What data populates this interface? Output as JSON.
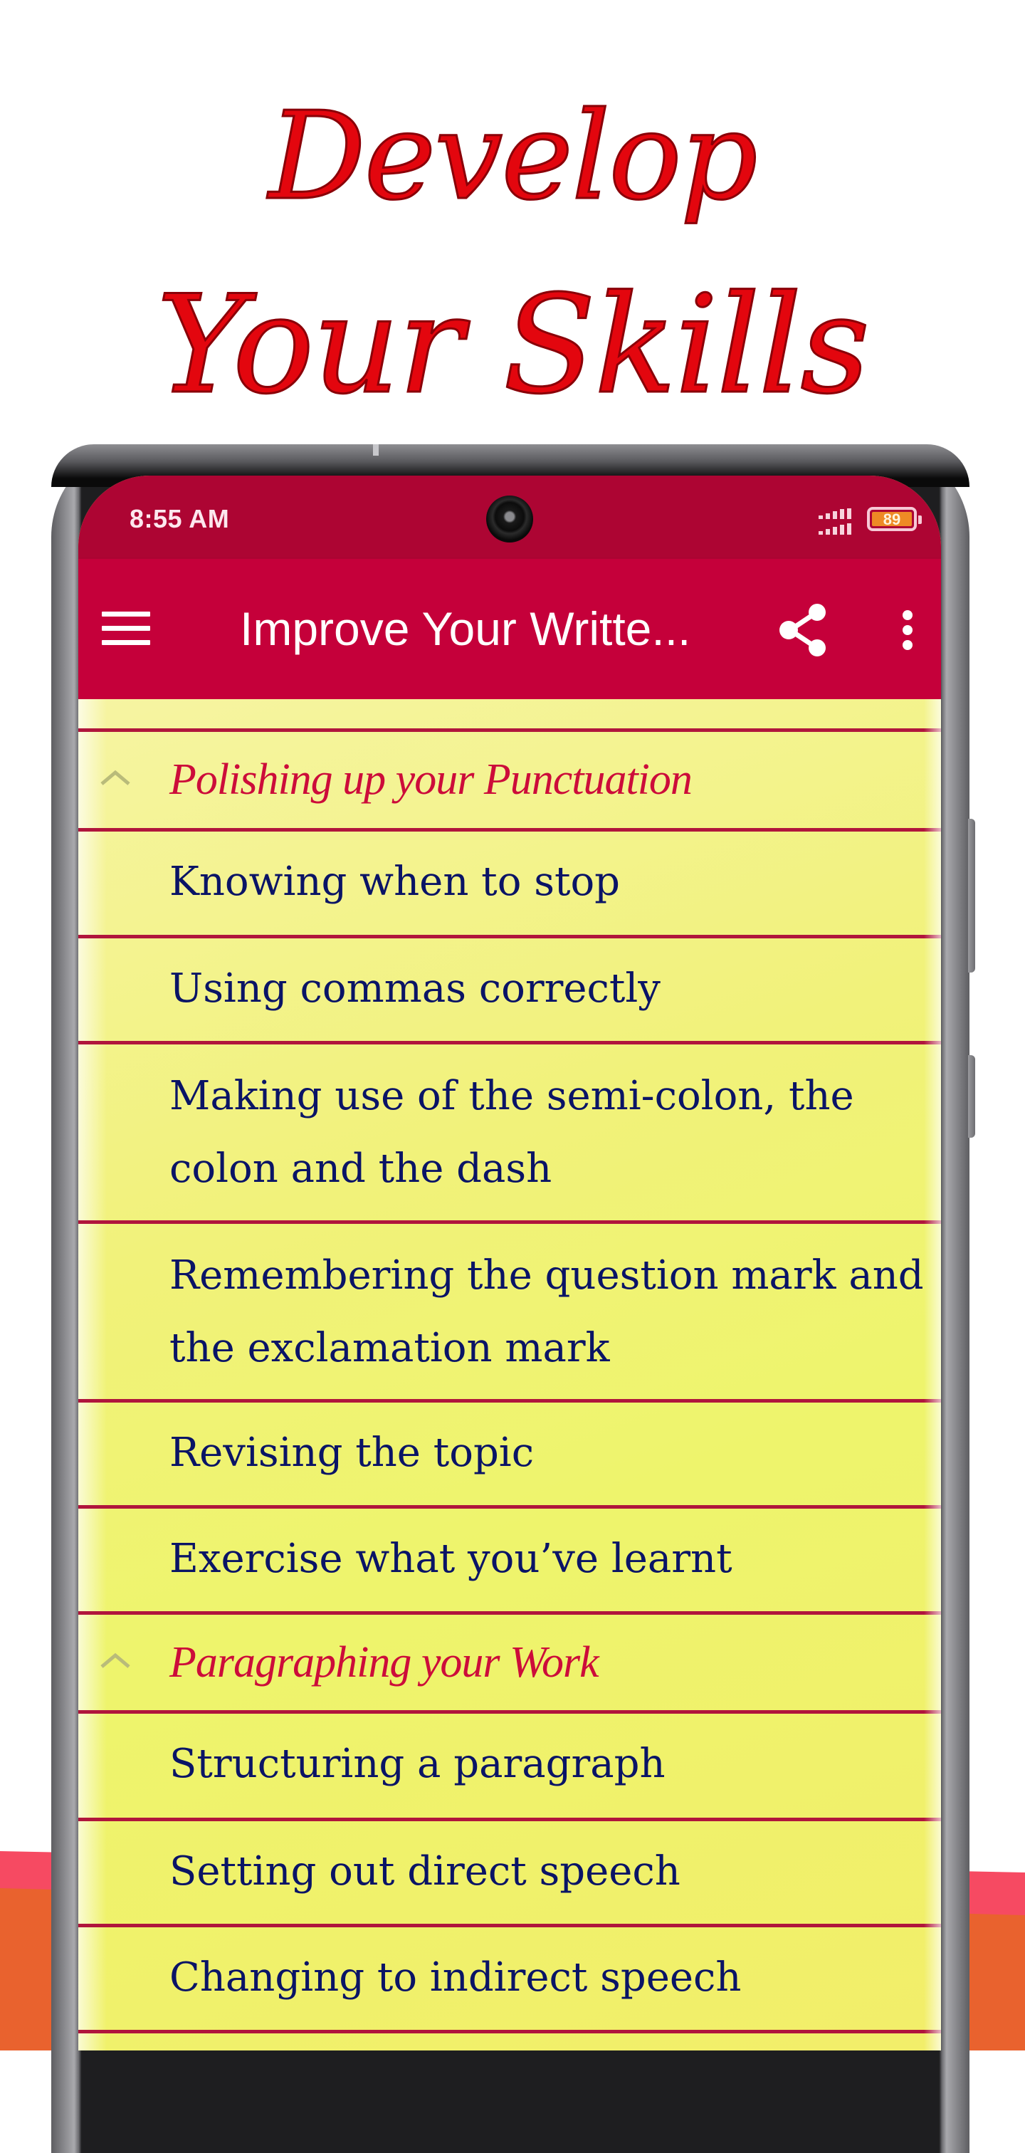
{
  "headline": {
    "line1": "Develop",
    "line2": "Your Skills"
  },
  "status_bar": {
    "time": "8:55 AM",
    "battery_level": "89",
    "icons": [
      "signal-icon",
      "battery-icon"
    ]
  },
  "app_bar": {
    "title": "Improve Your Writte...",
    "menu_icon": "hamburger-icon",
    "share_icon": "share-icon",
    "more_icon": "more-vertical-icon"
  },
  "colors": {
    "status_bar": "#ad0533",
    "app_bar": "#c5003a",
    "list_bg": "#f1f27a",
    "divider": "#b0153c",
    "header_text": "#cc0c3a",
    "item_text": "#0a1466",
    "headline": "#e3060e"
  },
  "list": {
    "sections": [
      {
        "title": "Polishing up your Punctuation",
        "expanded": true,
        "items": [
          "Knowing when to stop",
          "Using commas correctly",
          "Making use of the semi-colon, the colon and the dash",
          "Remembering the question mark and the exclamation mark",
          "Revising the topic",
          "Exercise what you’ve learnt"
        ]
      },
      {
        "title": "Paragraphing your Work",
        "expanded": true,
        "items": [
          "Structuring a paragraph",
          "Setting out direct speech",
          "Changing to indirect speech"
        ]
      }
    ]
  }
}
